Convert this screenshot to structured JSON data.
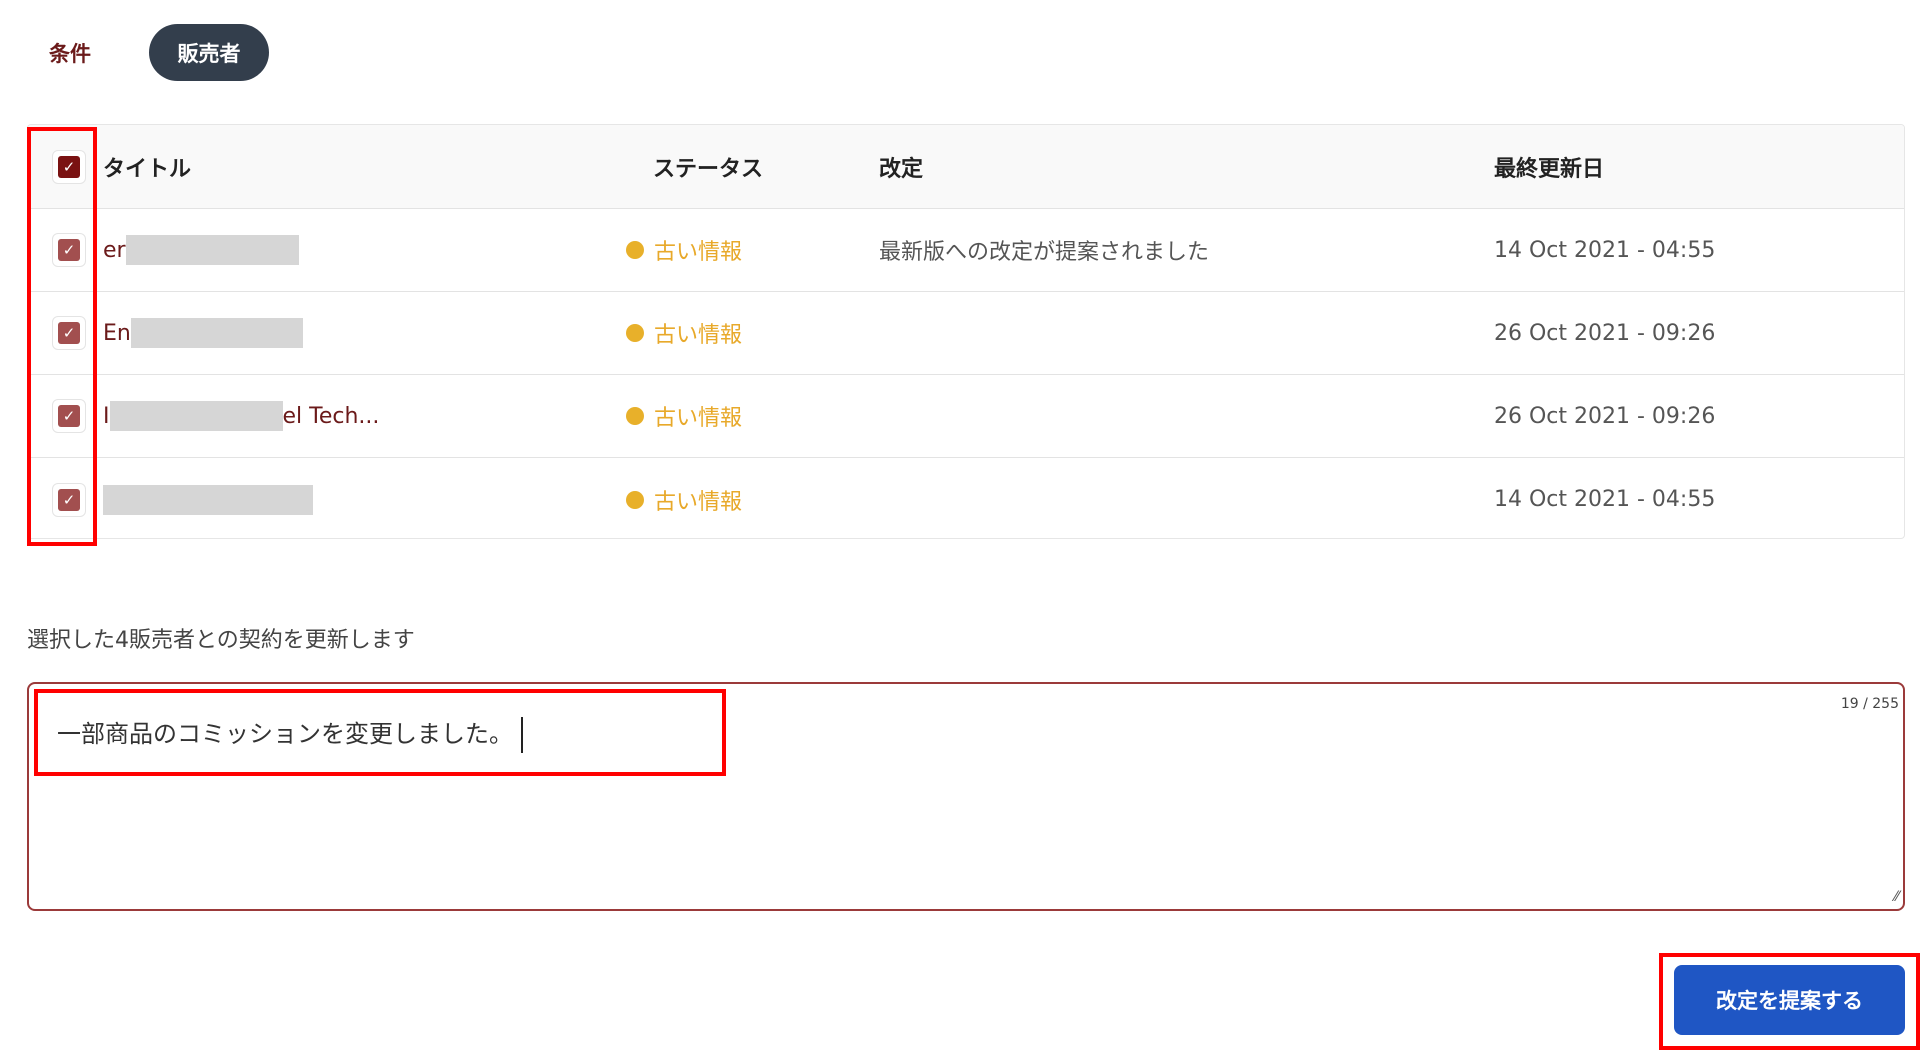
{
  "tabs": [
    {
      "label": "条件",
      "active": false
    },
    {
      "label": "販売者",
      "active": true
    }
  ],
  "table": {
    "headers": {
      "title": "タイトル",
      "status": "ステータス",
      "revision": "改定",
      "updated": "最終更新日"
    },
    "rows": [
      {
        "title_start": "er",
        "title_end": "",
        "status": "古い情報",
        "revision": "最新版への改定が提案されました",
        "updated": "14 Oct 2021 - 04:55",
        "checked": true
      },
      {
        "title_start": "En",
        "title_end": "",
        "status": "古い情報",
        "revision": "",
        "updated": "26 Oct 2021 - 09:26",
        "checked": true
      },
      {
        "title_start": "I",
        "title_end": "el Tech...",
        "status": "古い情報",
        "revision": "",
        "updated": "26 Oct 2021 - 09:26",
        "checked": true
      },
      {
        "title_start": "",
        "title_end": "",
        "status": "古い情報",
        "revision": "",
        "updated": "14 Oct 2021 - 04:55",
        "checked": true
      }
    ]
  },
  "note": "選択した4販売者との契約を更新します",
  "textarea": {
    "value": "一部商品のコミッションを変更しました。",
    "counter": "19 / 255"
  },
  "submit_label": "改定を提案する",
  "colors": {
    "accent": "#6b1a1a",
    "status": "#e8b02a",
    "button": "#1f56c4"
  }
}
